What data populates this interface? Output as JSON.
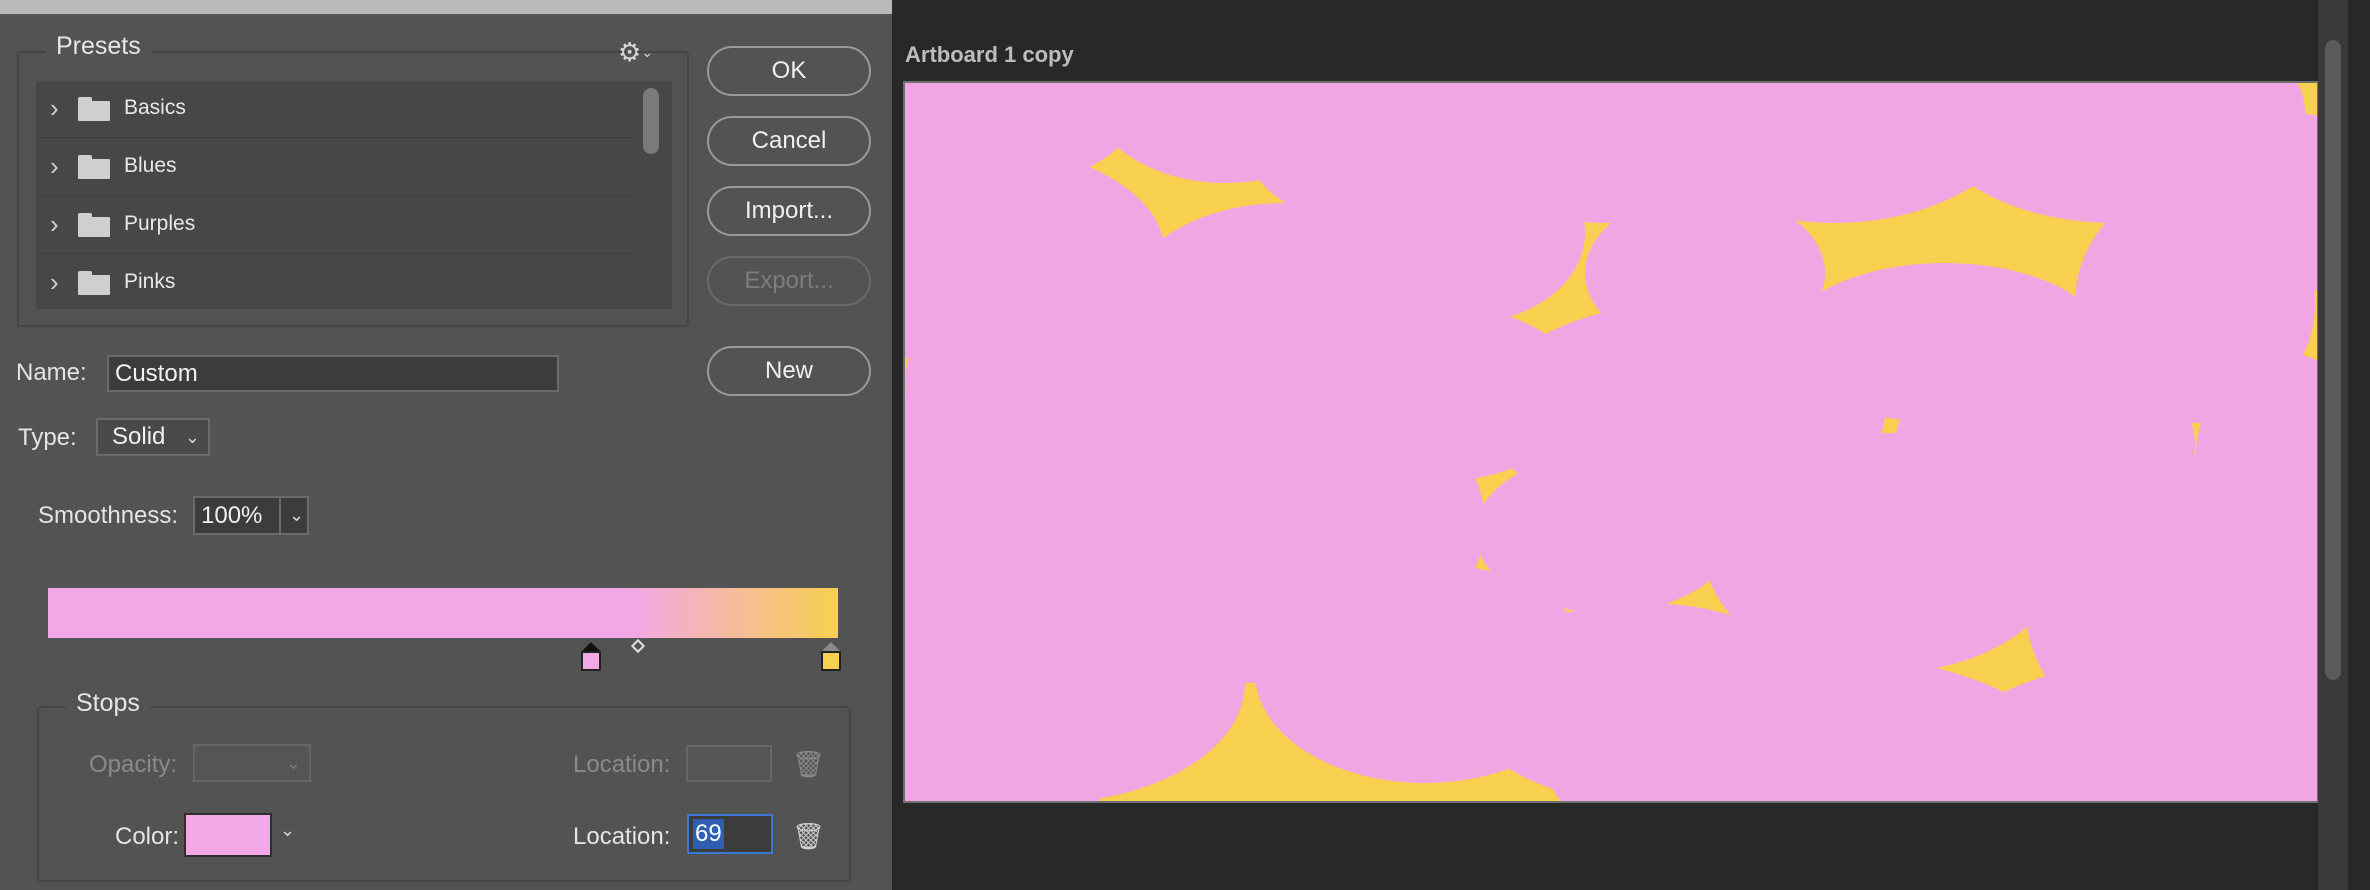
{
  "dialog": {
    "presets": {
      "legend": "Presets",
      "items": [
        {
          "label": "Basics"
        },
        {
          "label": "Blues"
        },
        {
          "label": "Purples"
        },
        {
          "label": "Pinks"
        }
      ]
    },
    "buttons": {
      "ok": "OK",
      "cancel": "Cancel",
      "import": "Import...",
      "export": "Export...",
      "new": "New"
    },
    "name": {
      "label": "Name:",
      "value": "Custom"
    },
    "type": {
      "label": "Type:",
      "value": "Solid"
    },
    "smoothness": {
      "label": "Smoothness:",
      "value": "100%"
    },
    "gradient": {
      "color_stops": [
        {
          "color": "#f2a8e6",
          "location": 69
        },
        {
          "color": "#f7d04f",
          "location": 100
        }
      ]
    },
    "stops": {
      "legend": "Stops",
      "opacity_label": "Opacity:",
      "opacity_location_label": "Location:",
      "color_label": "Color:",
      "color_value": "#f2a8e6",
      "color_location_label": "Location:",
      "color_location_value": "69"
    }
  },
  "canvas": {
    "artboard_title": "Artboard 1 copy",
    "colors": {
      "pink": "#f2a8e6",
      "yellow": "#f7d04f"
    }
  }
}
